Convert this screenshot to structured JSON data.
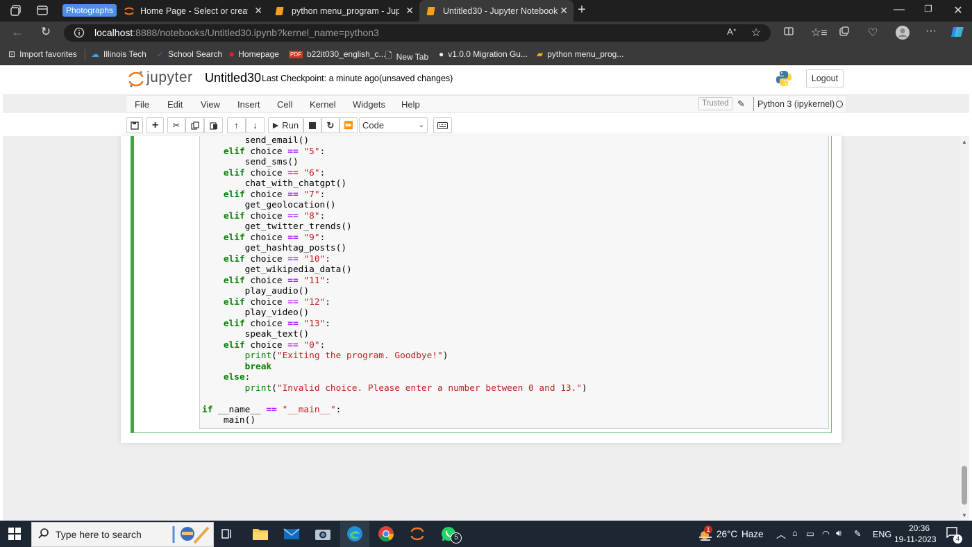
{
  "browser": {
    "group_label": "Photographs",
    "tabs": [
      {
        "title": "Home Page - Select or create a n",
        "icon": "jupyter-icon"
      },
      {
        "title": "python menu_program - Jupyter",
        "icon": "notebook-icon"
      },
      {
        "title": "Untitled30 - Jupyter Notebook",
        "icon": "notebook-icon",
        "active": true
      }
    ],
    "new_tab": "+",
    "url_host": "localhost",
    "url_rest": ":8888/notebooks/Untitled30.ipynb?kernel_name=python3",
    "favorites": [
      "Import favorites",
      "Illinois Tech",
      "School Search",
      "Homepage",
      "b22it030_english_c...",
      "New Tab",
      "v1.0.0 Migration Gu...",
      "python menu_prog..."
    ]
  },
  "jupyter": {
    "logo_text": "jupyter",
    "notebook_name": "Untitled30",
    "checkpoint": "Last Checkpoint: a minute ago",
    "unsaved": "(unsaved changes)",
    "logout": "Logout",
    "menu": [
      "File",
      "Edit",
      "View",
      "Insert",
      "Cell",
      "Kernel",
      "Widgets",
      "Help"
    ],
    "trusted": "Trusted",
    "kernel": "Python 3 (ipykernel)",
    "run_label": "Run",
    "cell_type": "Code",
    "code_lines": [
      "        send_email()",
      "    elif choice == \"5\":",
      "        send_sms()",
      "    elif choice == \"6\":",
      "        chat_with_chatgpt()",
      "    elif choice == \"7\":",
      "        get_geolocation()",
      "    elif choice == \"8\":",
      "        get_twitter_trends()",
      "    elif choice == \"9\":",
      "        get_hashtag_posts()",
      "    elif choice == \"10\":",
      "        get_wikipedia_data()",
      "    elif choice == \"11\":",
      "        play_audio()",
      "    elif choice == \"12\":",
      "        play_video()",
      "    elif choice == \"13\":",
      "        speak_text()",
      "    elif choice == \"0\":",
      "        print(\"Exiting the program. Goodbye!\")",
      "        break",
      "    else:",
      "        print(\"Invalid choice. Please enter a number between 0 and 13.\")",
      "",
      "if __name__ == \"__main__\":",
      "    main()"
    ]
  },
  "taskbar": {
    "search_placeholder": "Type here to search",
    "whatsapp_badge": "5",
    "weather_temp": "26°C",
    "weather_desc": "Haze",
    "weather_badge": "1",
    "language": "ENG",
    "time": "20:36",
    "date": "19-11-2023",
    "notification_count": "4"
  }
}
